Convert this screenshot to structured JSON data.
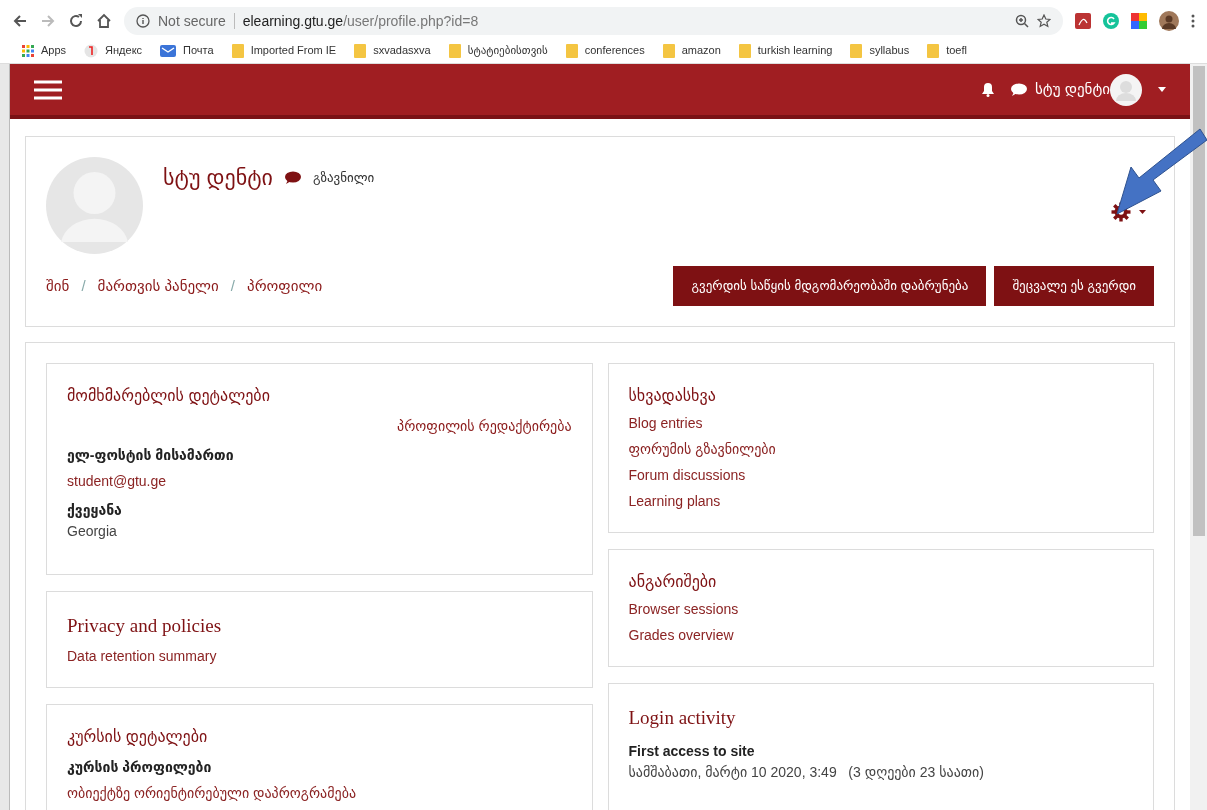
{
  "browser": {
    "security": "Not secure",
    "url_host": "elearning.gtu.ge",
    "url_path": "/user/profile.php?id=8",
    "bookmarks": [
      {
        "label": "Apps",
        "kind": "apps"
      },
      {
        "label": "Яндекс",
        "kind": "yandex"
      },
      {
        "label": "Почта",
        "kind": "mail"
      },
      {
        "label": "Imported From IE",
        "kind": "folder"
      },
      {
        "label": "sxvadasxva",
        "kind": "folder"
      },
      {
        "label": "სტატიებისთვის",
        "kind": "folder"
      },
      {
        "label": "conferences",
        "kind": "folder"
      },
      {
        "label": "amazon",
        "kind": "folder"
      },
      {
        "label": "turkish learning",
        "kind": "folder"
      },
      {
        "label": "syllabus",
        "kind": "folder"
      },
      {
        "label": "toefl",
        "kind": "folder"
      }
    ]
  },
  "header": {
    "user_name": "სტუ დენტი"
  },
  "profile": {
    "name": "სტუ დენტი",
    "message_label": "გზავნილი",
    "breadcrumb": [
      "შინ",
      "მართვის პანელი",
      "პროფილი"
    ],
    "breadcrumb_separator": "/",
    "buttons": [
      "გვერდის საწყის მდგომარეობაში დაბრუნება",
      "შეცვალე ეს გვერდი"
    ]
  },
  "left_cards": [
    {
      "title": "მომხმარებლის დეტალები",
      "kind": "plain",
      "items": [
        {
          "kind": "action",
          "text": "პროფილის რედაქტირება"
        },
        {
          "kind": "label",
          "text": "ელ-ფოსტის მისამართი"
        },
        {
          "kind": "link",
          "text": "student@gtu.ge"
        },
        {
          "kind": "label",
          "text": "ქვეყანა"
        },
        {
          "kind": "text",
          "text": "Georgia"
        }
      ]
    },
    {
      "title": "Privacy and policies",
      "kind": "serif",
      "items": [
        {
          "kind": "link",
          "text": "Data retention summary"
        }
      ]
    },
    {
      "title": "კურსის დეტალები",
      "kind": "plain",
      "items": [
        {
          "kind": "label",
          "text": "კურსის პროფილები"
        },
        {
          "kind": "link",
          "text": "ობიექტზე ორიენტირებული დაპროგრამება"
        }
      ]
    }
  ],
  "right_cards": [
    {
      "title": "სხვადასხვა",
      "kind": "plain",
      "items": [
        {
          "kind": "link",
          "text": "Blog entries"
        },
        {
          "kind": "link",
          "text": "ფორუმის გზავნილები"
        },
        {
          "kind": "link",
          "text": "Forum discussions"
        },
        {
          "kind": "link",
          "text": "Learning plans"
        }
      ]
    },
    {
      "title": "ანგარიშები",
      "kind": "plain",
      "items": [
        {
          "kind": "link",
          "text": "Browser sessions"
        },
        {
          "kind": "link",
          "text": "Grades overview"
        }
      ]
    },
    {
      "title": "Login activity",
      "kind": "serif",
      "items": [
        {
          "kind": "label",
          "text": "First access to site"
        },
        {
          "kind": "text",
          "text": "სამშაბათი, მარტი 10 2020, 3:49   (3 დღეები 23 საათი)"
        }
      ]
    }
  ]
}
